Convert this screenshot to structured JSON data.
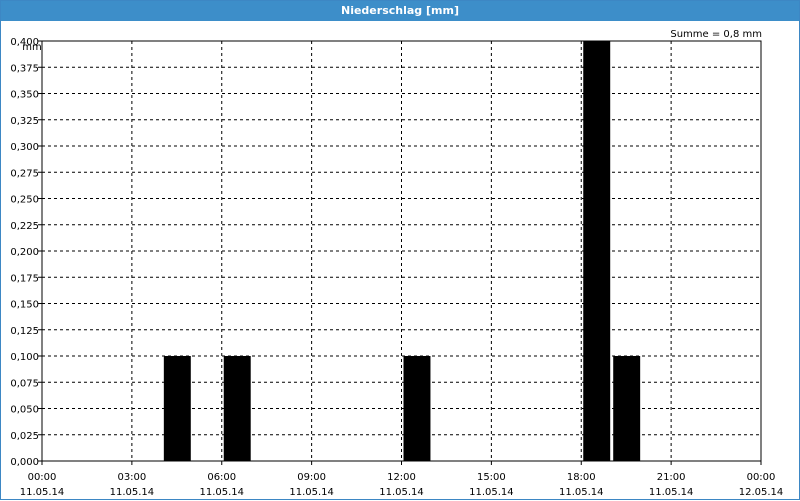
{
  "window": {
    "title": "Niederschlag [mm]"
  },
  "chart_data": {
    "type": "bar",
    "title": "Niederschlag [mm]",
    "ylabel": "mm",
    "annotation": "Summe = 0,8 mm",
    "ylim": [
      0,
      0.4
    ],
    "yticks": [
      "0,000",
      "0,025",
      "0,050",
      "0,075",
      "0,100",
      "0,125",
      "0,150",
      "0,175",
      "0,200",
      "0,225",
      "0,250",
      "0,275",
      "0,300",
      "0,325",
      "0,350",
      "0,375",
      "0,400"
    ],
    "xlim_hours": [
      0,
      24
    ],
    "xticks": [
      {
        "time": "00:00",
        "date": "11.05.14"
      },
      {
        "time": "03:00",
        "date": "11.05.14"
      },
      {
        "time": "06:00",
        "date": "11.05.14"
      },
      {
        "time": "09:00",
        "date": "11.05.14"
      },
      {
        "time": "12:00",
        "date": "11.05.14"
      },
      {
        "time": "15:00",
        "date": "11.05.14"
      },
      {
        "time": "18:00",
        "date": "11.05.14"
      },
      {
        "time": "21:00",
        "date": "11.05.14"
      },
      {
        "time": "00:00",
        "date": "12.05.14"
      }
    ],
    "bars": [
      {
        "start": "04:00",
        "end": "05:00",
        "value": 0.1
      },
      {
        "start": "06:00",
        "end": "07:00",
        "value": 0.1
      },
      {
        "start": "12:00",
        "end": "13:00",
        "value": 0.1
      },
      {
        "start": "18:00",
        "end": "19:00",
        "value": 0.4
      },
      {
        "start": "19:00",
        "end": "20:00",
        "value": 0.1
      }
    ],
    "bar_color": "#000000",
    "grid": true,
    "grid_style": "dashed"
  }
}
